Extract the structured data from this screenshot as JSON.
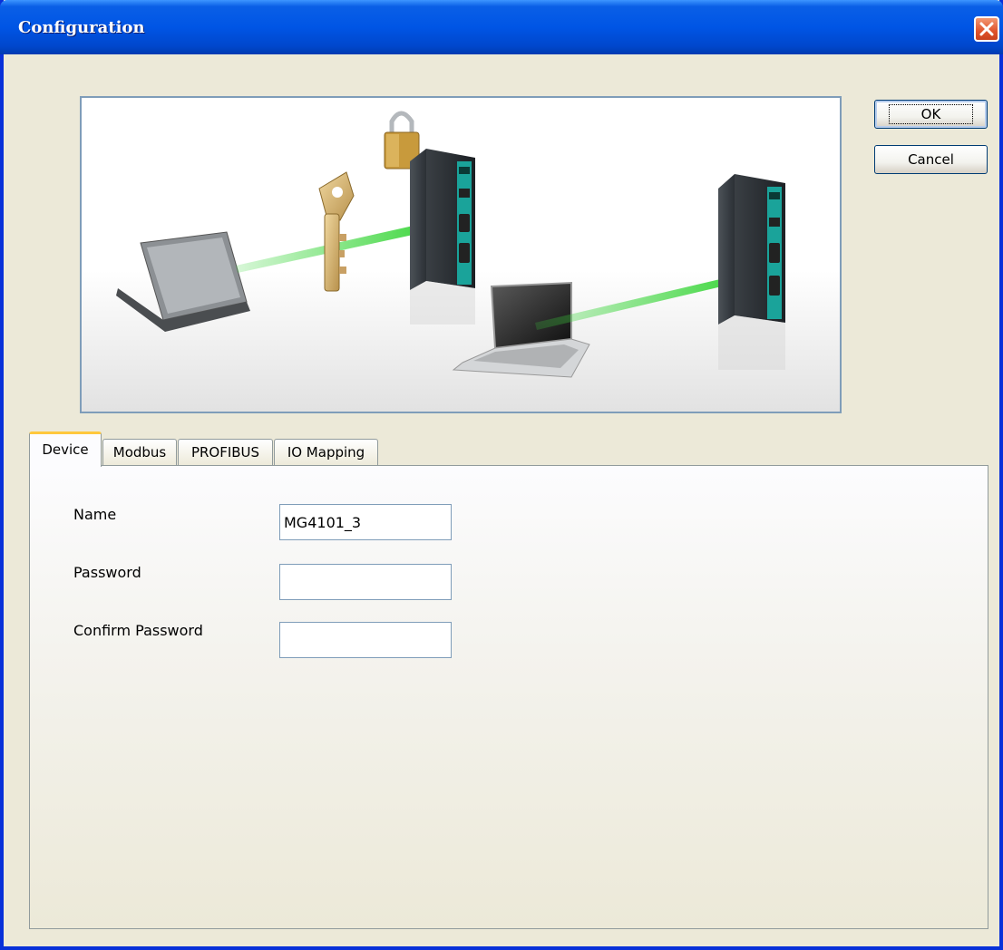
{
  "window": {
    "title": "Configuration"
  },
  "buttons": {
    "ok_label": "OK",
    "cancel_label": "Cancel"
  },
  "tabs": [
    {
      "label": "Device",
      "active": true
    },
    {
      "label": "Modbus",
      "active": false
    },
    {
      "label": "PROFIBUS",
      "active": false
    },
    {
      "label": "IO Mapping",
      "active": false
    }
  ],
  "device_form": {
    "name_label": "Name",
    "name_value": "MG4101_3",
    "password_label": "Password",
    "password_value": "",
    "confirm_password_label": "Confirm Password",
    "confirm_password_value": ""
  },
  "banner": {
    "icons": [
      "laptop-icon",
      "key-icon",
      "padlock-icon",
      "gateway-device-icon",
      "laptop-icon",
      "gateway-device-icon"
    ],
    "arrow_color": "#3cd63c"
  },
  "colors": {
    "titlebar": "#0055e5",
    "window_bg": "#ece9d8",
    "close_button": "#e0532c",
    "active_tab_accent": "#ffc83c",
    "input_border": "#7f9db9"
  }
}
